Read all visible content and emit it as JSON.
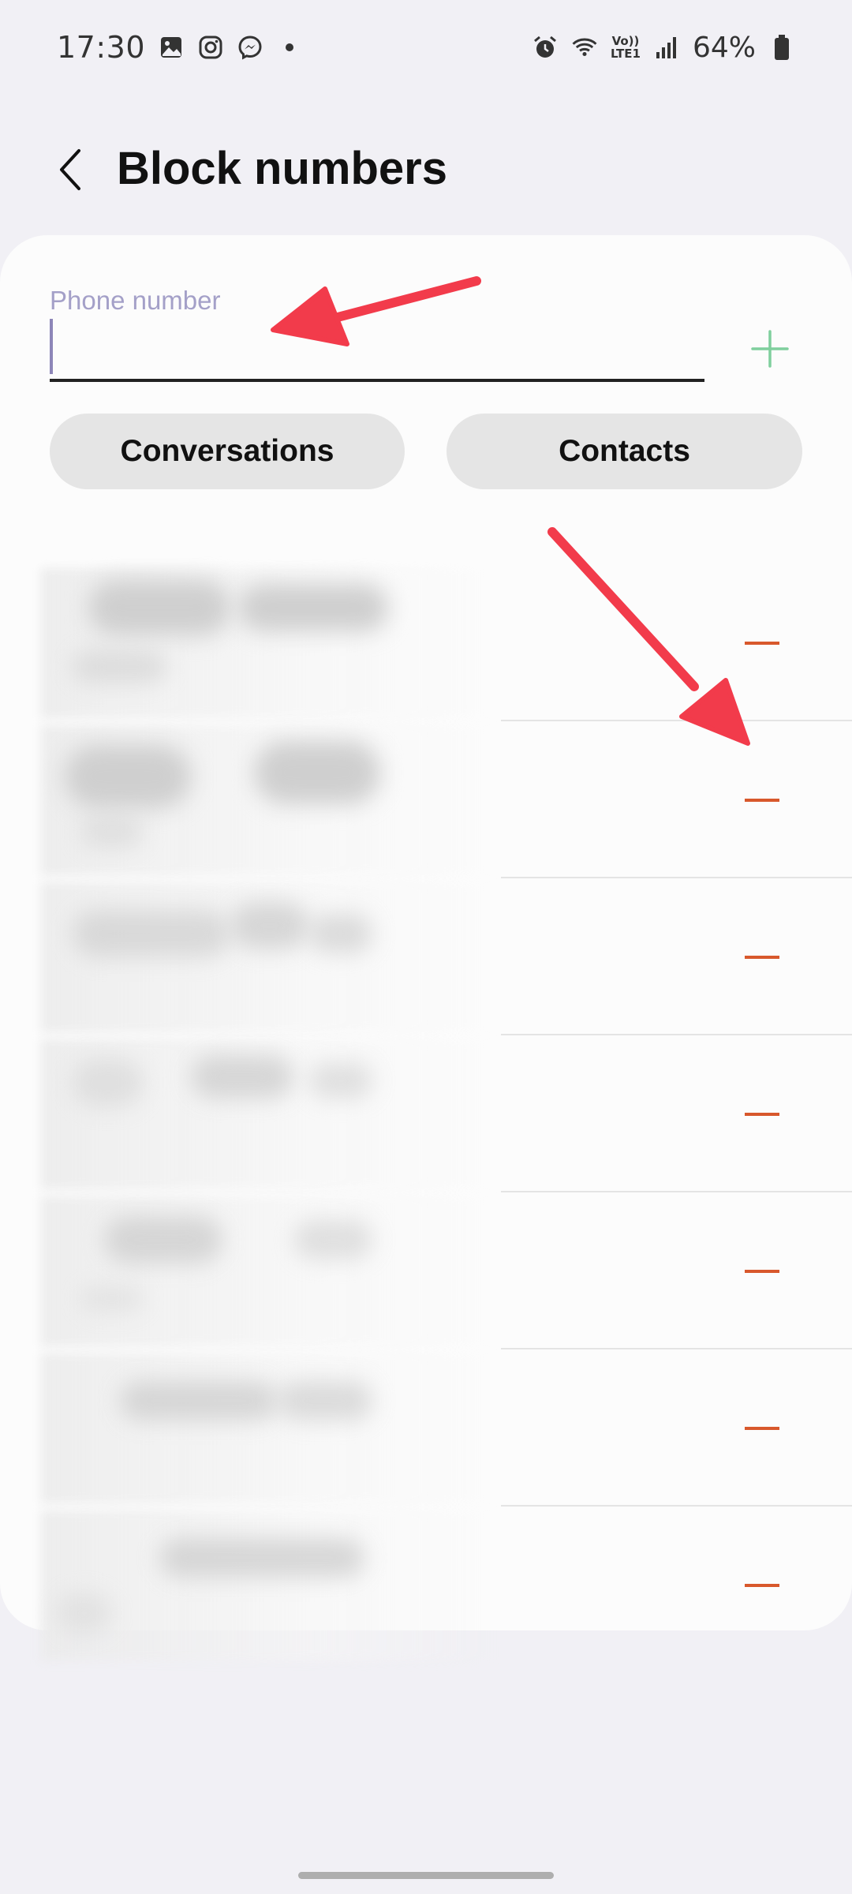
{
  "status_bar": {
    "time": "17:30",
    "left_icons": [
      "gallery-icon",
      "instagram-icon",
      "messenger-icon"
    ],
    "right_icons": [
      "alarm-icon",
      "wifi-icon",
      "volte-icon",
      "signal-icon",
      "battery-icon"
    ],
    "volte_top": "Vo))",
    "volte_bottom": "LTE1",
    "battery": "64%"
  },
  "header": {
    "title": "Block numbers",
    "back_icon": "back-chevron-icon"
  },
  "form": {
    "phone_label": "Phone number",
    "phone_value": "",
    "add_icon": "plus-icon"
  },
  "buttons": {
    "conversations": "Conversations",
    "contacts": "Contacts"
  },
  "blocked_list": {
    "rows": 7,
    "remove_icon": "minus-icon"
  },
  "colors": {
    "background": "#f1f0f5",
    "card": "#fcfcfc",
    "label": "#a4a0c8",
    "add_icon": "#7fcf9d",
    "remove_icon": "#d8582c",
    "annotation_arrow": "#f23b4b",
    "pill": "#e5e5e5"
  }
}
